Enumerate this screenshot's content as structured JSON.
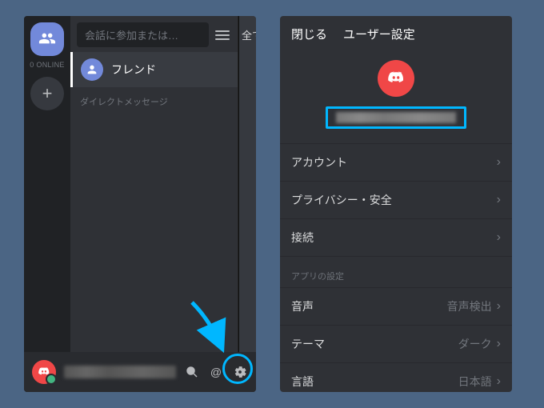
{
  "left": {
    "online_count": "0 ONLINE",
    "search_placeholder": "会話に参加または…",
    "friends_label": "フレンド",
    "dm_header": "ダイレクトメッセージ",
    "sliver_text": "全て"
  },
  "right": {
    "close_label": "閉じる",
    "title": "ユーザー設定",
    "items": {
      "account": "アカウント",
      "privacy": "プライバシー・安全",
      "connections": "接続"
    },
    "section_app": "アプリの設定",
    "items2": {
      "voice": {
        "label": "音声",
        "value": "音声検出"
      },
      "theme": {
        "label": "テーマ",
        "value": "ダーク"
      },
      "language": {
        "label": "言語",
        "value": "日本語"
      }
    }
  }
}
